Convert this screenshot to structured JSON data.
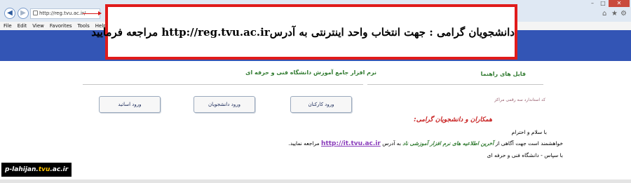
{
  "browser": {
    "address": "http://reg.tvu.ac.ir/",
    "menu": [
      "File",
      "Edit",
      "View",
      "Favorites",
      "Tools",
      "Help"
    ]
  },
  "notice": {
    "text_before": "دانشجویان گرامی : جهت انتخاب واحد اینترنتی به آدرس",
    "url": "http://reg.tvu.ac.ir",
    "text_after": " مراجعه فرمایید"
  },
  "page": {
    "right_header": "فایل های راهنما",
    "left_header": "نرم افزار جامع آموزش دانشگاه فنی و حرفه ای",
    "sub_note": "کد استاندارد سه رقمی مراکز",
    "buttons": {
      "staff": "ورود کارکنان",
      "students": "ورود دانشجویان",
      "professors": "ورود اساتید"
    },
    "message": {
      "heading": "همکاران و دانشجویان گرامی:",
      "greeting": "با سلام و احترام",
      "line_start": "خواهشمند است جهت آگاهی از ",
      "line_emphasis": "آخرین اطلاعیه های نرم افزار آموزشی ناد",
      "line_middle": " به آدرس ",
      "line_link": "http://it.tvu.ac.ir",
      "line_end": " مراجعه نمایید.",
      "signature": "با سپاس - دانشگاه فنی و حرفه ای"
    }
  },
  "watermark": {
    "prefix": "p-lahijan.",
    "accent": "tvu",
    "suffix": ".ac.ir"
  },
  "colors": {
    "banner": "#3355b5",
    "notice_border": "#e01b1b",
    "heading_green": "#2f7a2f",
    "message_red": "#c82020",
    "link_purple": "#8a3dbb"
  },
  "icons": [
    "back-arrow-icon",
    "forward-arrow-icon",
    "page-icon",
    "home-icon",
    "star-icon",
    "gear-icon"
  ]
}
